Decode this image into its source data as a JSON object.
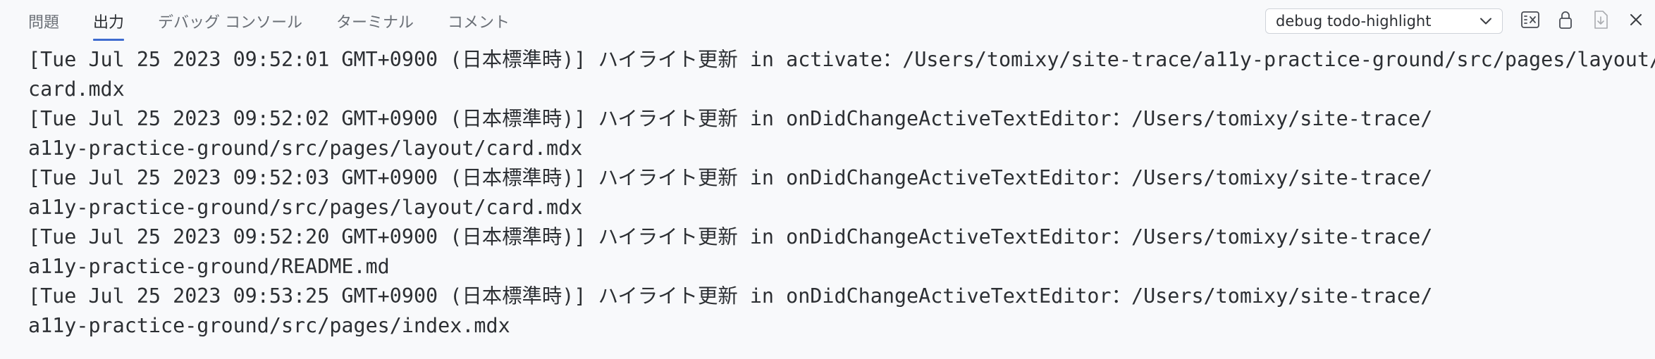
{
  "tabs": [
    {
      "label": "問題",
      "active": false
    },
    {
      "label": "出力",
      "active": true
    },
    {
      "label": "デバッグ コンソール",
      "active": false
    },
    {
      "label": "ターミナル",
      "active": false
    },
    {
      "label": "コメント",
      "active": false
    }
  ],
  "actions": {
    "channel_select": {
      "value": "debug todo-highlight"
    },
    "icons": [
      "clear-output-icon",
      "lock-icon",
      "download-icon",
      "close-icon"
    ]
  },
  "output": {
    "lines": [
      "[Tue Jul 25 2023 09:52:01 GMT+0900 (日本標準時)] ハイライト更新 in activate：/Users/tomixy/site-trace/a11y-practice-ground/src/pages/layout/",
      "card.mdx",
      "[Tue Jul 25 2023 09:52:02 GMT+0900 (日本標準時)] ハイライト更新 in onDidChangeActiveTextEditor：/Users/tomixy/site-trace/",
      "a11y-practice-ground/src/pages/layout/card.mdx",
      "[Tue Jul 25 2023 09:52:03 GMT+0900 (日本標準時)] ハイライト更新 in onDidChangeActiveTextEditor：/Users/tomixy/site-trace/",
      "a11y-practice-ground/src/pages/layout/card.mdx",
      "[Tue Jul 25 2023 09:52:20 GMT+0900 (日本標準時)] ハイライト更新 in onDidChangeActiveTextEditor：/Users/tomixy/site-trace/",
      "a11y-practice-ground/README.md",
      "[Tue Jul 25 2023 09:53:25 GMT+0900 (日本標準時)] ハイライト更新 in onDidChangeActiveTextEditor：/Users/tomixy/site-trace/",
      "a11y-practice-ground/src/pages/index.mdx"
    ]
  },
  "colors": {
    "background": "#f8f9fb",
    "text": "#2c2f33",
    "tab_inactive": "#6a6f76",
    "accent": "#3f6ccf"
  }
}
